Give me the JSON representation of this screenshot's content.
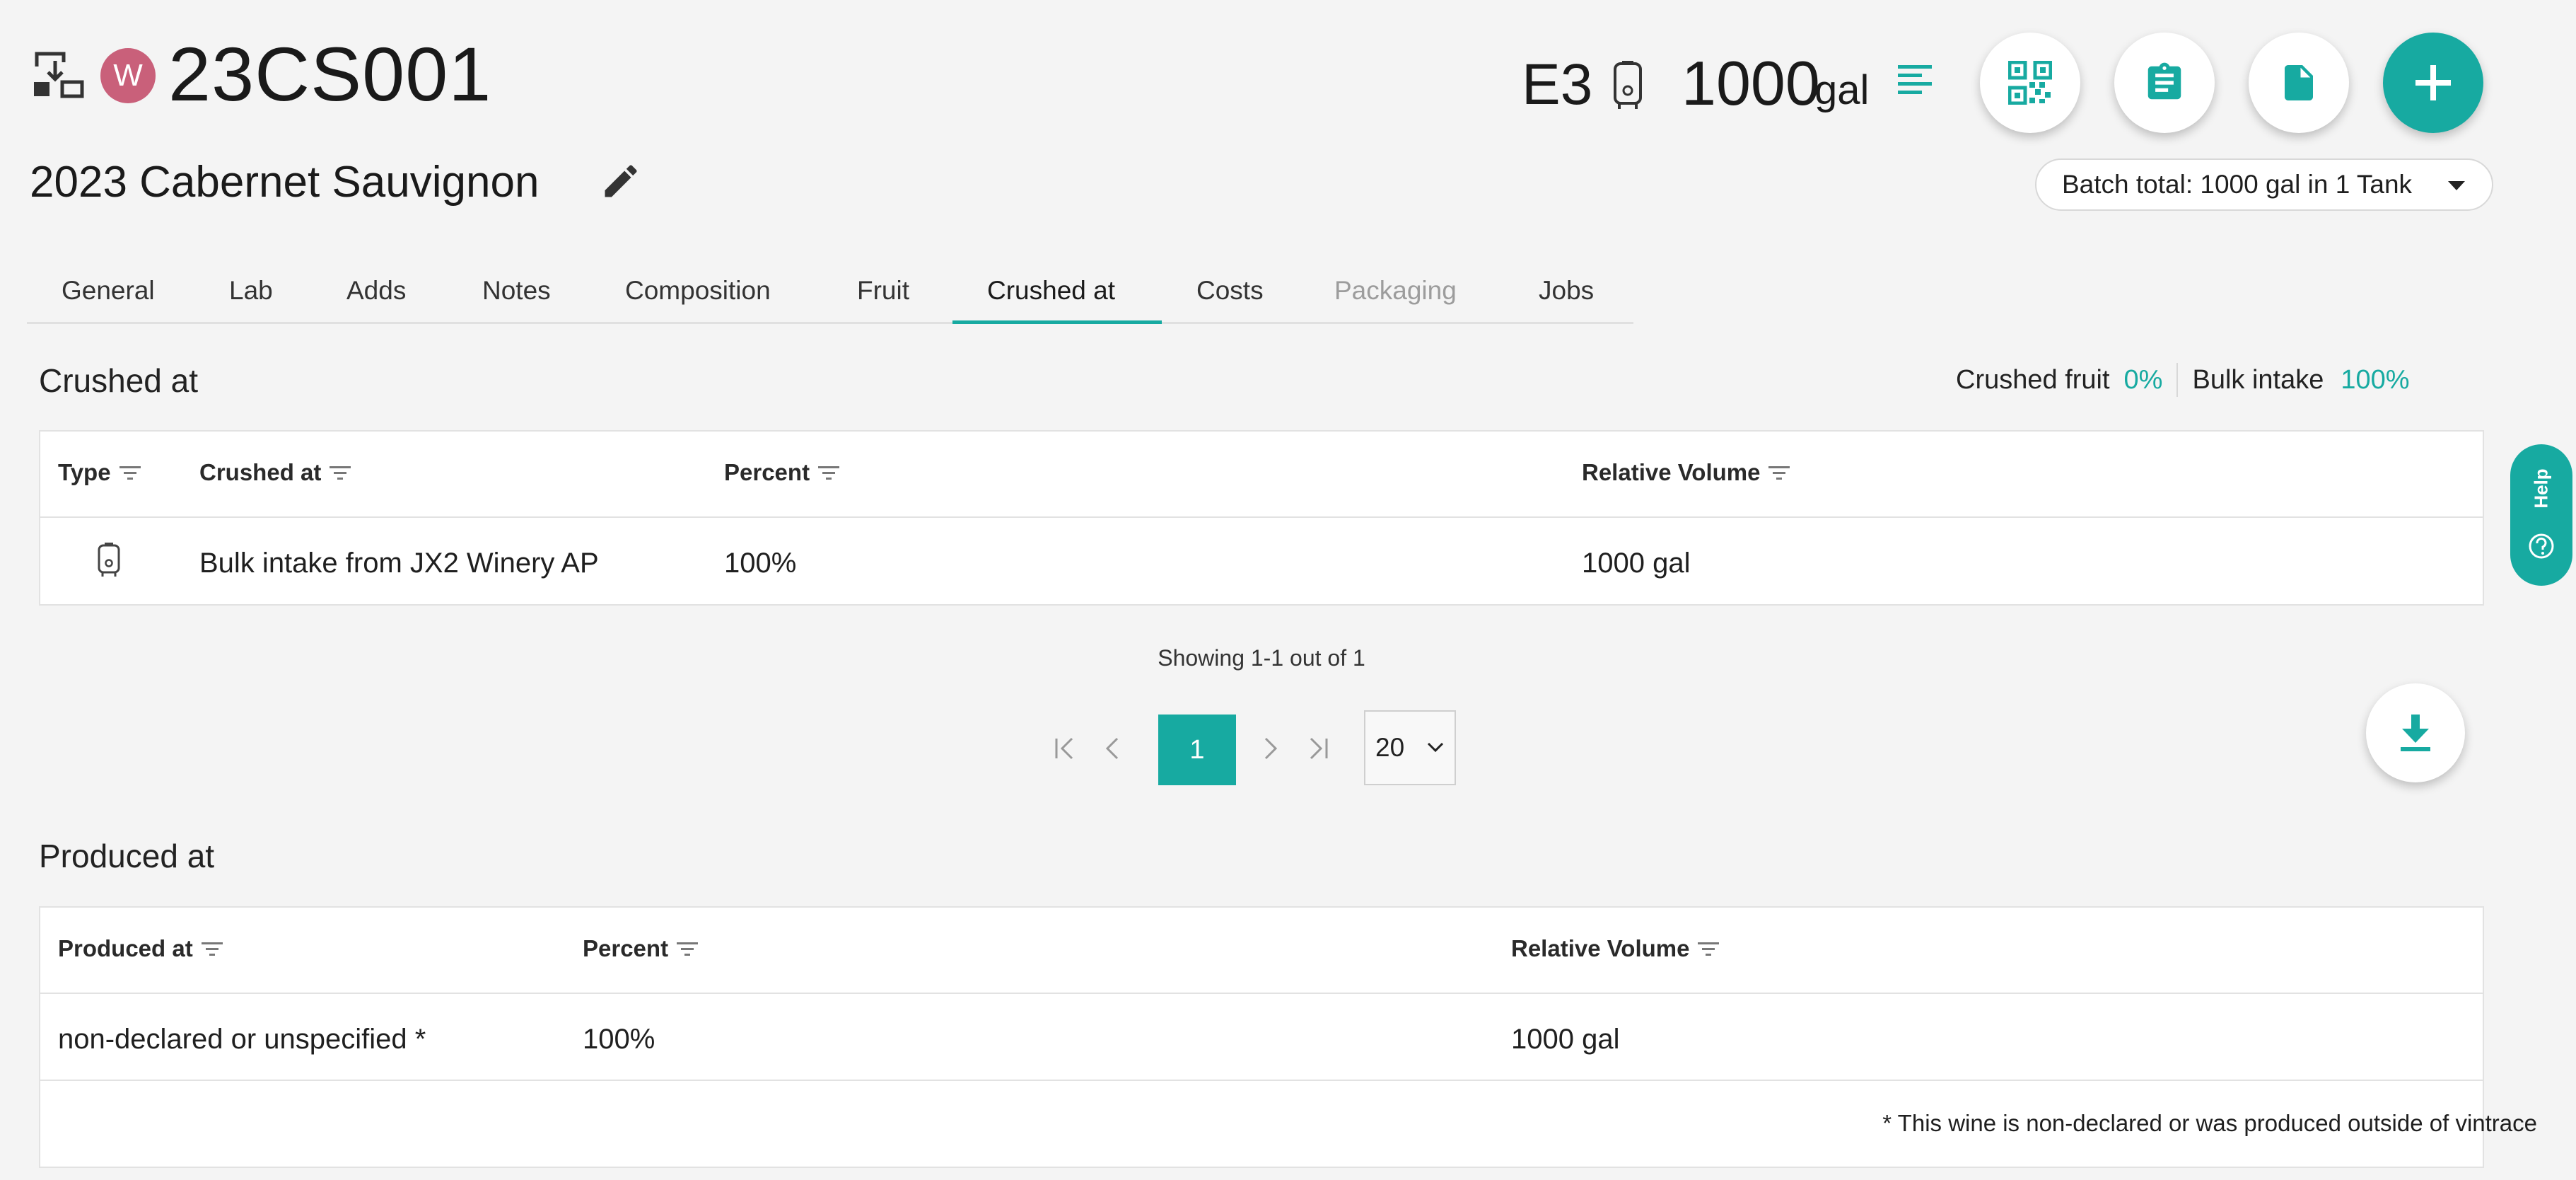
{
  "header": {
    "avatar_letter": "W",
    "batch_code": "23CS001",
    "wine_name": "2023 Cabernet Sauvignon",
    "vessel_code": "E3",
    "vessel_volume": "1000",
    "vessel_unit": "gal",
    "batch_total": "Batch total: 1000 gal in 1 Tank"
  },
  "tabs": [
    {
      "label": "General"
    },
    {
      "label": "Lab"
    },
    {
      "label": "Adds"
    },
    {
      "label": "Notes"
    },
    {
      "label": "Composition"
    },
    {
      "label": "Fruit"
    },
    {
      "label": "Crushed at"
    },
    {
      "label": "Costs"
    },
    {
      "label": "Packaging"
    },
    {
      "label": "Jobs"
    }
  ],
  "active_tab": "Crushed at",
  "crushed_section": {
    "title": "Crushed at",
    "crushed_fruit_label": "Crushed fruit",
    "crushed_fruit_value": "0%",
    "bulk_intake_label": "Bulk intake",
    "bulk_intake_value": "100%",
    "columns": [
      "Type",
      "Crushed at",
      "Percent",
      "Relative Volume"
    ],
    "rows": [
      {
        "type_icon": "tank-icon",
        "crushed_at": "Bulk intake from JX2 Winery AP",
        "percent": "100%",
        "relative_volume": "1000 gal"
      }
    ]
  },
  "pagination": {
    "showing": "Showing 1-1 out of 1",
    "current_page": "1",
    "page_size": "20"
  },
  "produced_section": {
    "title": "Produced at",
    "columns": [
      "Produced at",
      "Percent",
      "Relative Volume"
    ],
    "rows": [
      {
        "produced_at": "non-declared or unspecified *",
        "percent": "100%",
        "relative_volume": "1000 gal"
      }
    ],
    "footnote": "* This wine is non-declared or was produced outside of vintrace"
  },
  "help": {
    "label": "Help"
  },
  "colors": {
    "accent": "#17aaa1",
    "avatar": "#c9607a",
    "background": "#f4f4f4"
  }
}
